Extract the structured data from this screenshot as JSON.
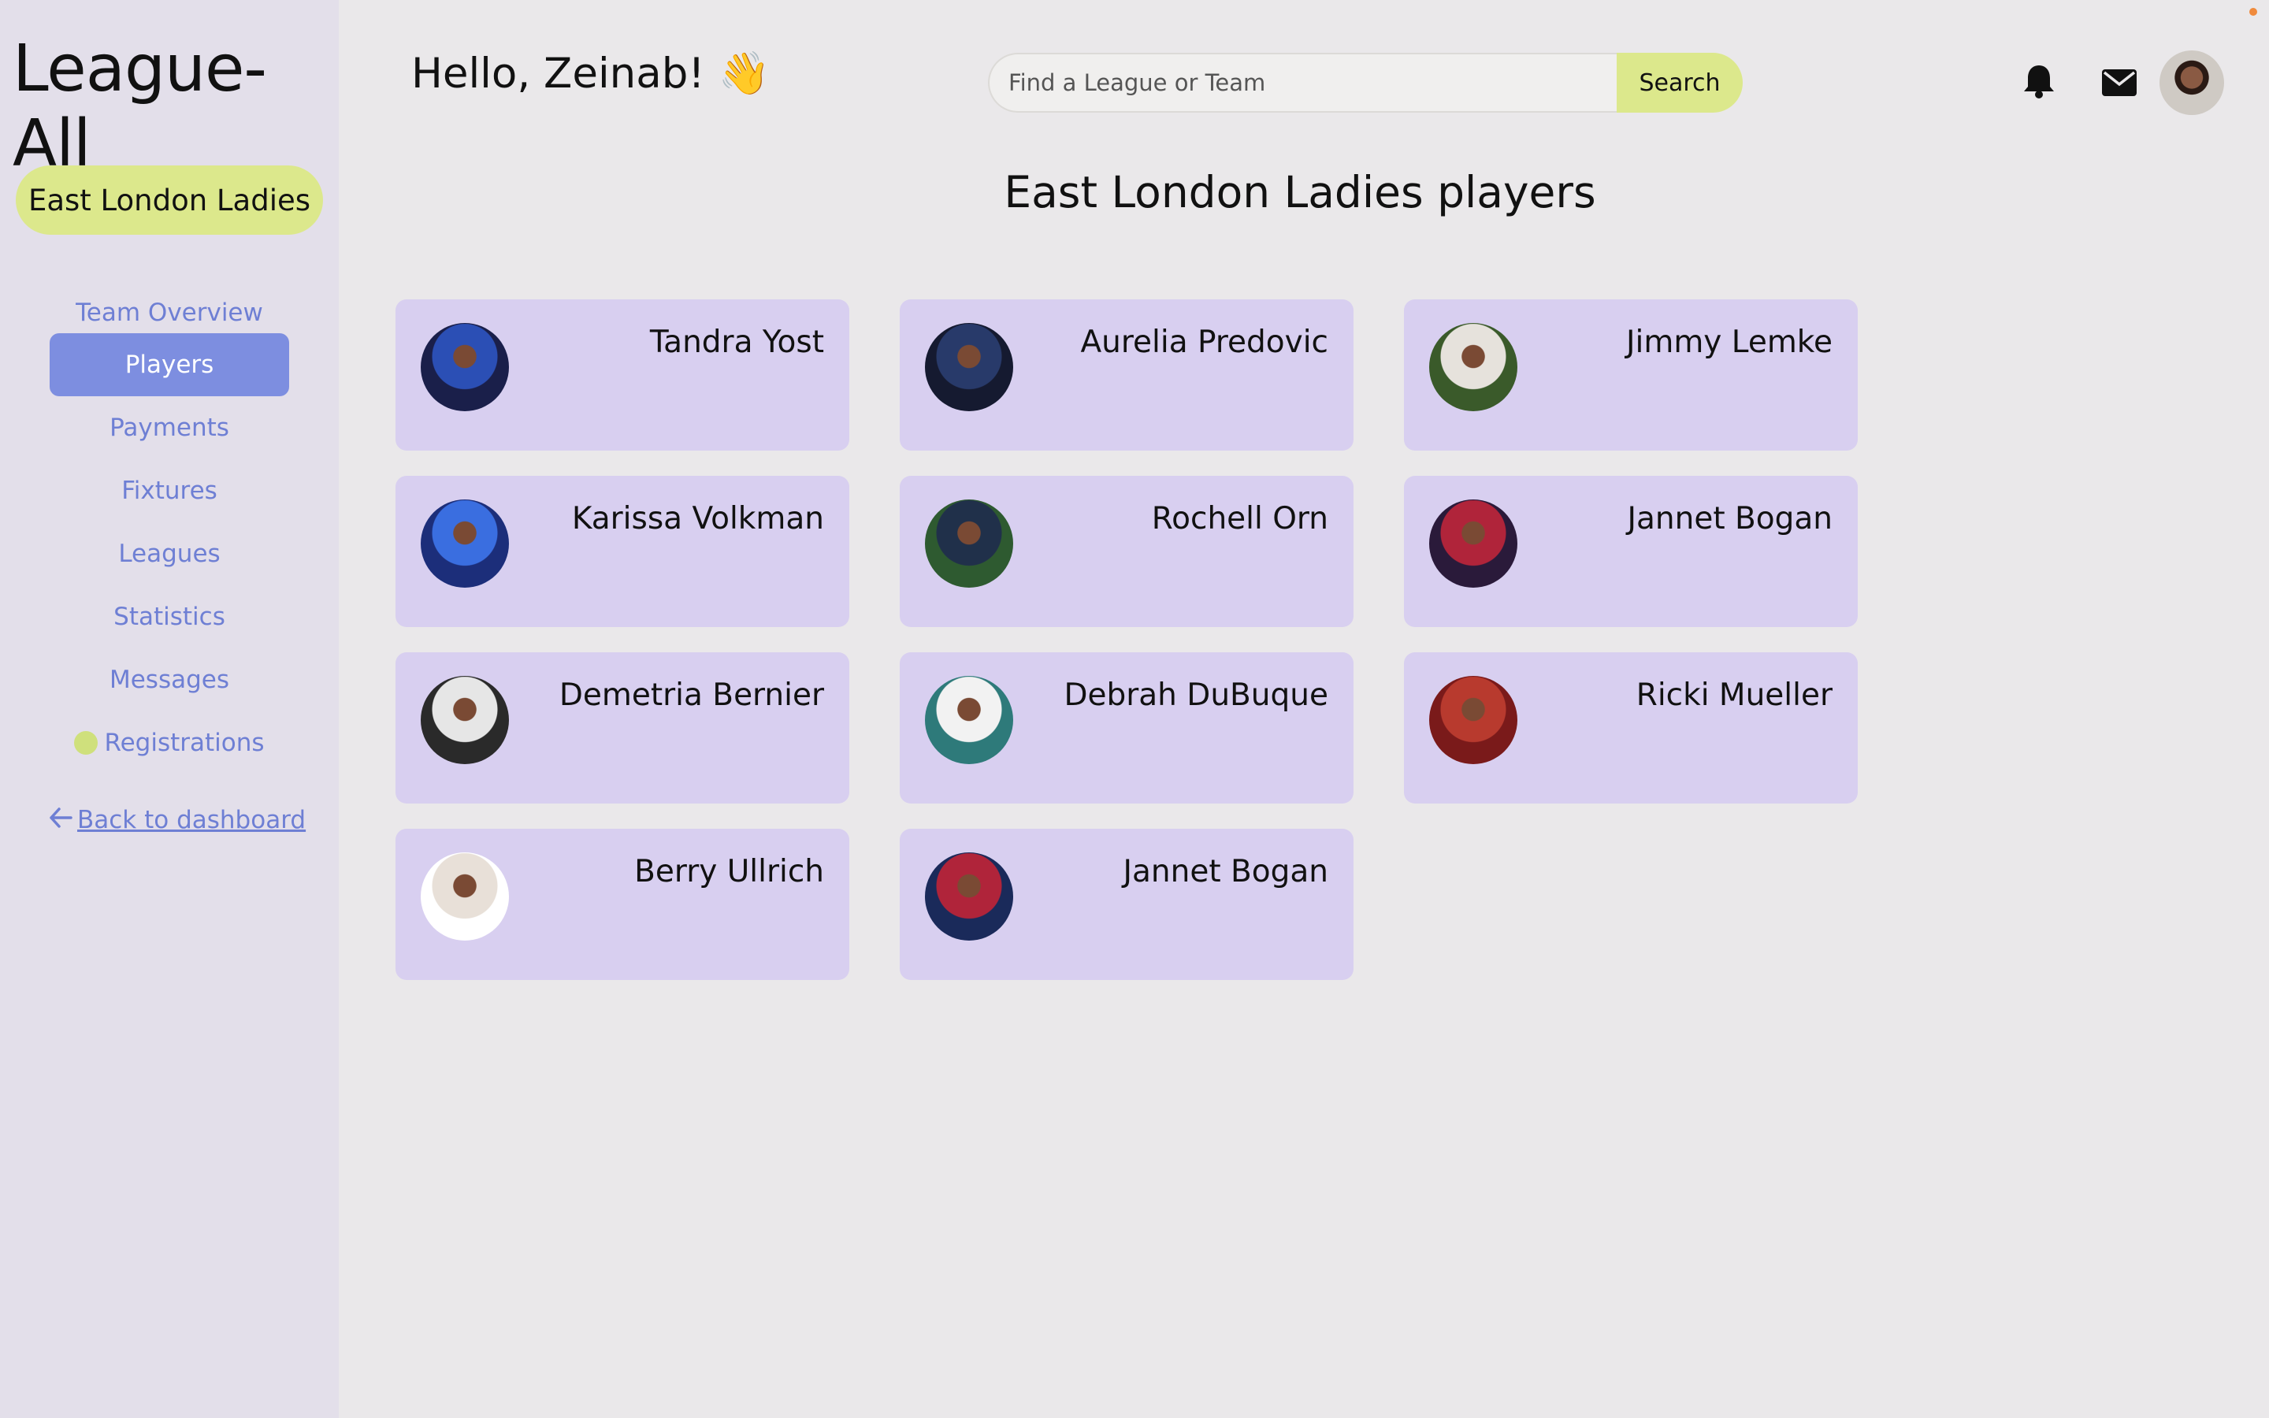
{
  "app": {
    "name": "League-All"
  },
  "sidebar": {
    "team_name": "East London Ladies",
    "nav": [
      {
        "label": "Team Overview",
        "active": false
      },
      {
        "label": "Players",
        "active": true
      },
      {
        "label": "Payments",
        "active": false
      },
      {
        "label": "Fixtures",
        "active": false
      },
      {
        "label": "Leagues",
        "active": false
      },
      {
        "label": "Statistics",
        "active": false
      },
      {
        "label": "Messages",
        "active": false
      },
      {
        "label": "Registrations",
        "active": false
      }
    ],
    "back_link": "Back to dashboard"
  },
  "header": {
    "greeting": "Hello, Zeinab! 👋",
    "search": {
      "placeholder": "Find a League or Team",
      "value": "",
      "button": "Search"
    },
    "icons": [
      "bell-icon",
      "mail-icon",
      "user-avatar"
    ]
  },
  "main": {
    "title": "East London Ladies players",
    "players": [
      {
        "name": "Tandra Yost",
        "photo": [
          "#1a1f4a",
          "#2b4fb5"
        ]
      },
      {
        "name": "Aurelia Predovic",
        "photo": [
          "#151a30",
          "#283a6a"
        ]
      },
      {
        "name": "Jimmy Lemke",
        "photo": [
          "#3a5a2a",
          "#e6e2dc"
        ]
      },
      {
        "name": "Karissa Volkman",
        "photo": [
          "#1c2e7a",
          "#3a6ee0"
        ]
      },
      {
        "name": "Rochell Orn",
        "photo": [
          "#2e5a30",
          "#20304a"
        ]
      },
      {
        "name": "Jannet Bogan",
        "photo": [
          "#2a1a3a",
          "#b0243a"
        ]
      },
      {
        "name": "Demetria Bernier",
        "photo": [
          "#2a2a2a",
          "#e6e6e6"
        ]
      },
      {
        "name": "Debrah DuBuque",
        "photo": [
          "#2e7a7a",
          "#f2f2f2"
        ]
      },
      {
        "name": "Ricki Mueller",
        "photo": [
          "#7a1a1a",
          "#b83a2e"
        ]
      },
      {
        "name": "Berry Ullrich",
        "photo": [
          "#ffffff",
          "#e8e0d8"
        ]
      },
      {
        "name": "Jannet Bogan",
        "photo": [
          "#1a2a5a",
          "#b0243a"
        ]
      }
    ]
  },
  "colors": {
    "accent": "#dce88c",
    "nav_text": "#6e7fd4",
    "nav_active_bg": "#7d8ee0",
    "card_bg": "#d8cff0",
    "sidebar_bg": "#e3dfea"
  }
}
